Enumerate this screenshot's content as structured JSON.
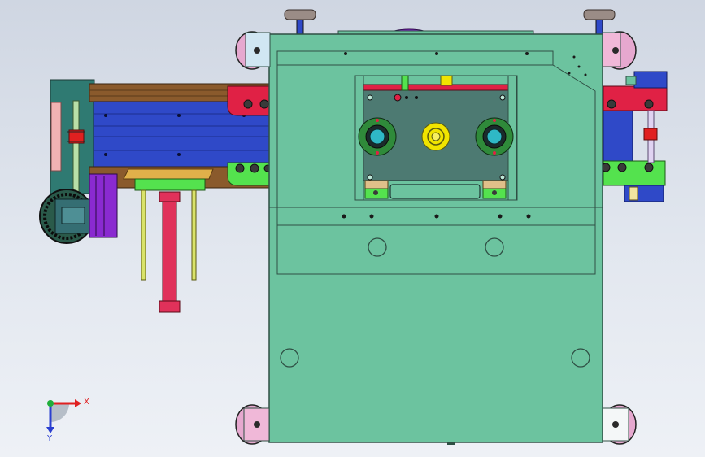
{
  "viewport": {
    "background_top": "#cfd6e2",
    "background_bottom": "#eef1f6"
  },
  "triad": {
    "x_label": "X",
    "y_label": "Y",
    "x_color": "#e02020",
    "y_color": "#2a3fd0",
    "origin_color": "#1fae3a"
  },
  "colors": {
    "frame_green": "#6cc39f",
    "frame_edge": "#2f4f44",
    "conveyor_blue": "#2f49c8",
    "rail_brown": "#8a5a2c",
    "rail_red": "#e02145",
    "rail_green": "#54e24e",
    "window_gray": "#4d7a72",
    "cylinder_pink": "#e0315a",
    "rod_yellow": "#d9e36a",
    "knob_gray": "#9a8c86",
    "caster_pink": "#e6a8cf",
    "gear_yellow": "#f1e400",
    "purple": "#8a2ad0"
  }
}
